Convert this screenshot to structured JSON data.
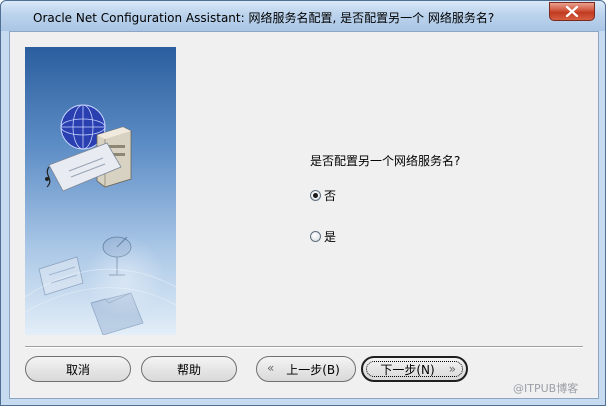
{
  "window": {
    "title": "Oracle Net Configuration Assistant: 网络服务名配置, 是否配置另一个 网络服务名?",
    "close_icon": "close-icon"
  },
  "content": {
    "question": "是否配置另一个网络服务名?",
    "options": [
      {
        "label": "否",
        "selected": true
      },
      {
        "label": "是",
        "selected": false
      }
    ]
  },
  "buttons": {
    "cancel": "取消",
    "help": "帮助",
    "back": "上一步(B)",
    "next": "下一步(N)"
  },
  "watermark": "@ITPUB博客",
  "colors": {
    "art_top": "#2d5fa0",
    "art_bottom": "#dce9f6",
    "frame": "#c7dbf0",
    "close_button": "#c8462d"
  }
}
